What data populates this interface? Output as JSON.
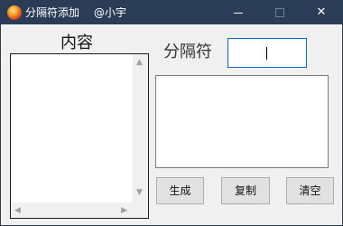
{
  "window": {
    "title": "分隔符添加",
    "author": "@小宇",
    "controls": {
      "minimize": "—",
      "maximize": "□",
      "close": "✕"
    },
    "colors": {
      "titlebar": "#2b3d56",
      "background": "#f0f0f0",
      "focus_border": "#0a6ac8"
    }
  },
  "content": {
    "label": "内容",
    "value": ""
  },
  "separator": {
    "label": "分隔符",
    "value": ""
  },
  "result": {
    "value": ""
  },
  "buttons": {
    "generate": "生成",
    "copy": "复制",
    "clear": "清空"
  },
  "scrollbar_icons": {
    "up": "▲",
    "down": "▼",
    "left": "◀",
    "right": "▶"
  }
}
